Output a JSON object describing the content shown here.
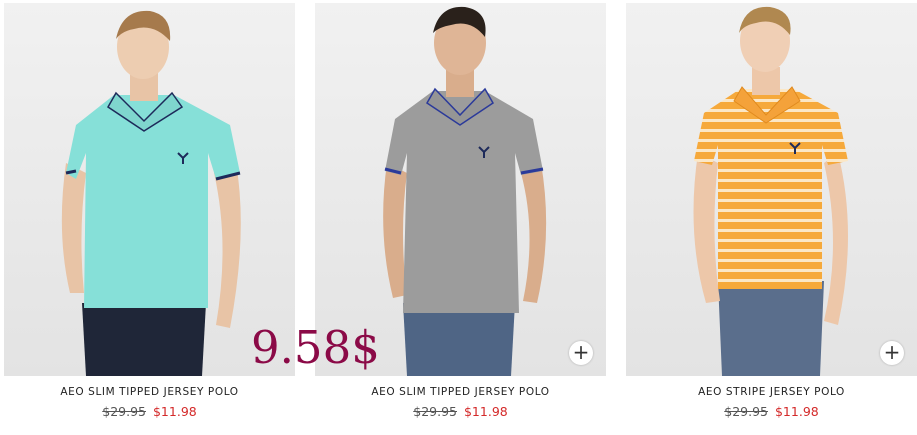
{
  "products": [
    {
      "name": "AEO SLIM TIPPED JERSEY POLO",
      "original_price": "$29.95",
      "sale_price": "$11.98",
      "shirt_color": "#86e0d8",
      "show_add_button": false
    },
    {
      "name": "AEO SLIM TIPPED JERSEY POLO",
      "original_price": "$29.95",
      "sale_price": "$11.98",
      "shirt_color": "#9c9c9c",
      "show_add_button": true
    },
    {
      "name": "AEO STRIPE JERSEY POLO",
      "original_price": "$29.95",
      "sale_price": "$11.98",
      "shirt_color": "#f6a93b",
      "show_add_button": true
    }
  ],
  "overlay_price": "9.58$",
  "add_button_symbol": "+",
  "colors": {
    "sale": "#d42a2a",
    "overlay": "#8b0a47"
  }
}
